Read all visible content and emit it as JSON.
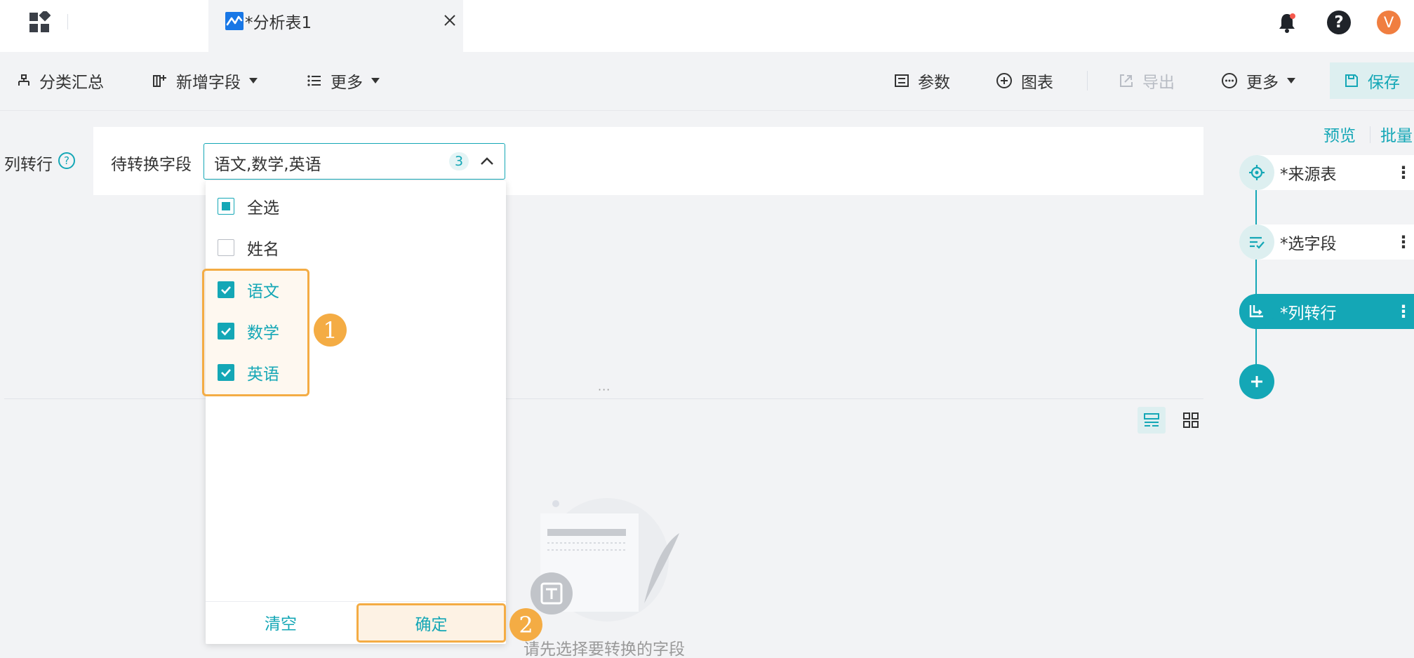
{
  "tab": {
    "title": "*分析表1"
  },
  "header": {
    "avatar_letter": "V"
  },
  "toolbar": {
    "group_summary": "分类汇总",
    "add_field": "新增字段",
    "more_left": "更多",
    "params": "参数",
    "chart": "图表",
    "export": "导出",
    "more_right": "更多",
    "save": "保存"
  },
  "config": {
    "label": "列转行",
    "help": "?",
    "field_label": "待转换字段",
    "selected_value": "语文,数学,英语",
    "selected_count": "3"
  },
  "dropdown": {
    "options": [
      {
        "label": "全选",
        "state": "partial"
      },
      {
        "label": "姓名",
        "state": "unchecked"
      },
      {
        "label": "语文",
        "state": "checked"
      },
      {
        "label": "数学",
        "state": "checked"
      },
      {
        "label": "英语",
        "state": "checked"
      }
    ],
    "clear": "清空",
    "confirm": "确定",
    "badge_1": "1",
    "badge_2": "2"
  },
  "splitter": {
    "handle": "···"
  },
  "empty_state": {
    "text": "请先选择要转换的字段"
  },
  "flow": {
    "preview": "预览",
    "batch": "批量",
    "nodes": [
      {
        "label": "*来源表",
        "icon": "target-icon",
        "active": false
      },
      {
        "label": "*选字段",
        "icon": "field-select-icon",
        "active": false
      },
      {
        "label": "*列转行",
        "icon": "pivot-icon",
        "active": true
      }
    ],
    "more": "⋮"
  },
  "colors": {
    "accent": "#14a7b6",
    "highlight": "#f4ac44",
    "avatar": "#f07e40"
  }
}
